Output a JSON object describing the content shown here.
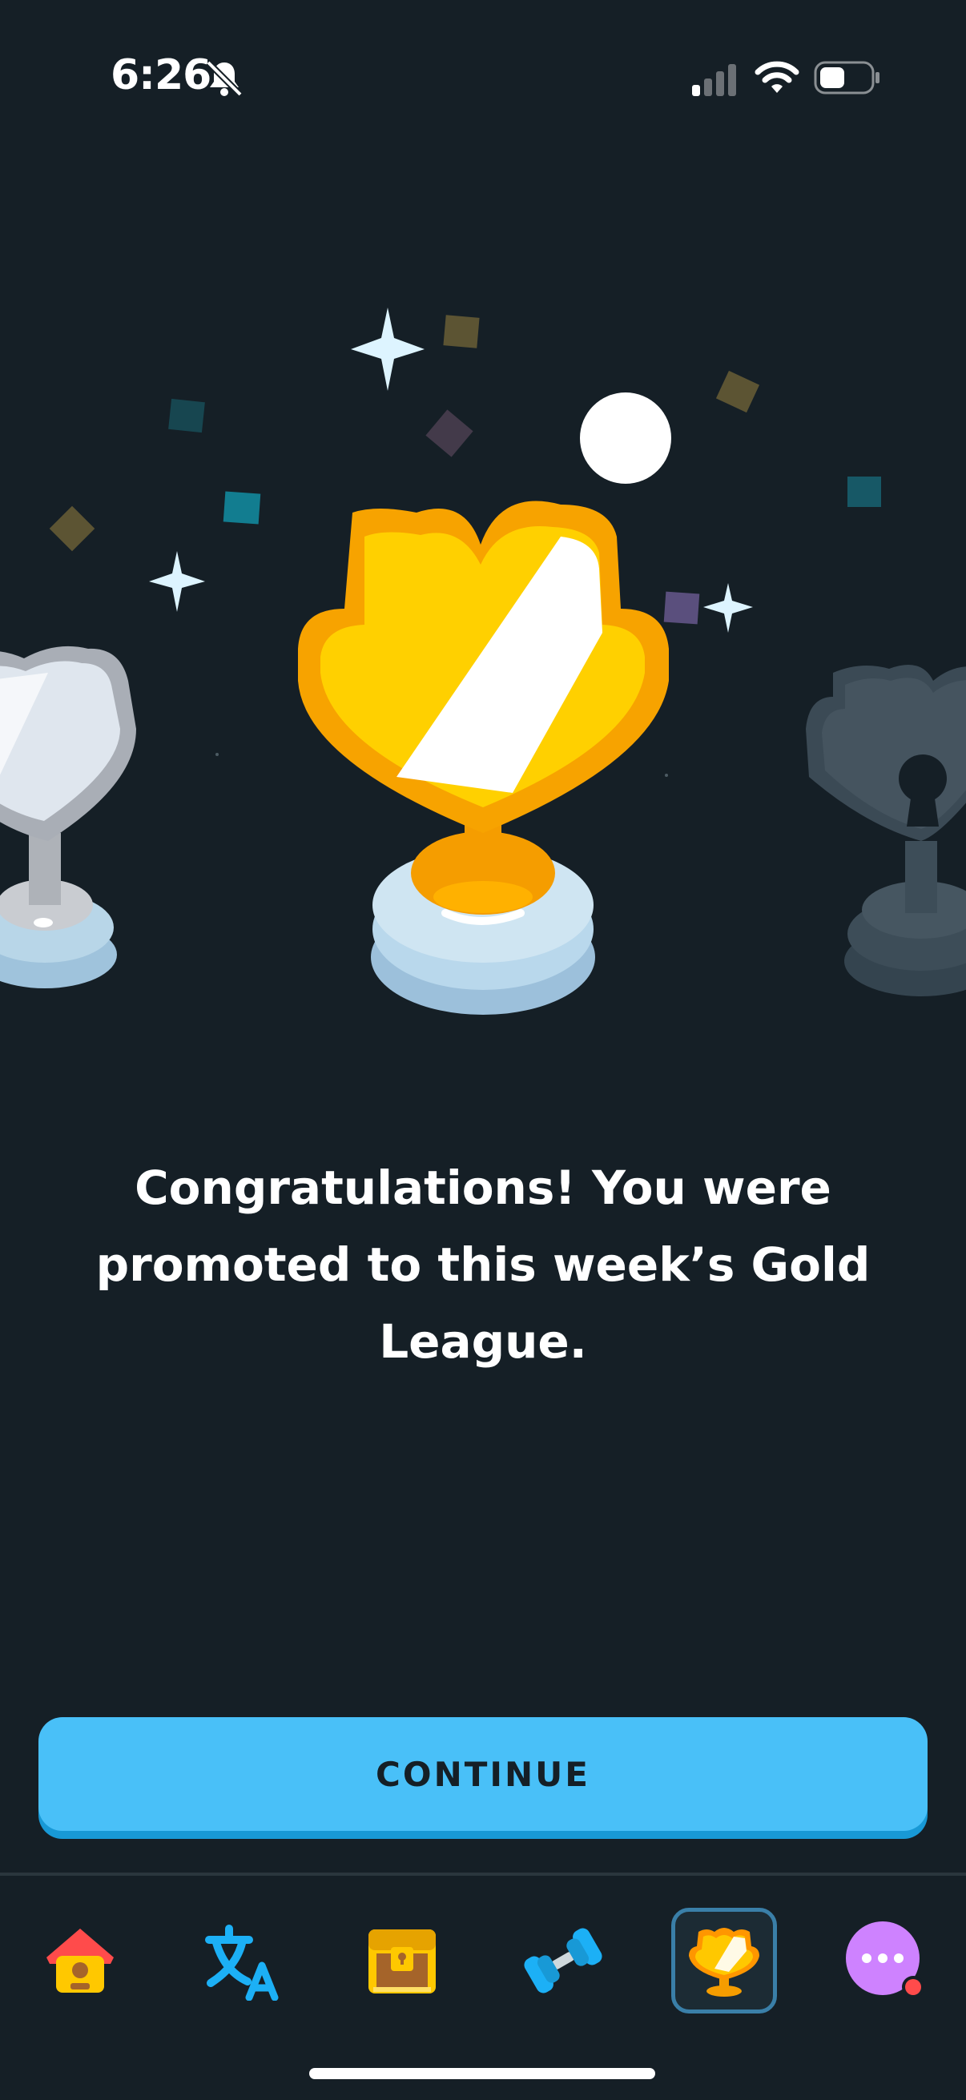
{
  "status_bar": {
    "time": "6:26",
    "icons": [
      "bell-slash-icon",
      "cellular-signal-icon",
      "wifi-icon",
      "battery-icon"
    ]
  },
  "league": {
    "trophies": [
      "silver-trophy",
      "gold-trophy",
      "locked-trophy"
    ],
    "current": "Gold"
  },
  "message": {
    "text": "Congratulations! You were promoted to this week’s Gold League."
  },
  "continue_button": {
    "label": "CONTINUE"
  },
  "tab_bar": {
    "tabs": [
      {
        "icon": "home-icon",
        "active": false
      },
      {
        "icon": "translate-icon",
        "active": false
      },
      {
        "icon": "treasure-chest-icon",
        "active": false
      },
      {
        "icon": "dumbbell-icon",
        "active": false
      },
      {
        "icon": "trophy-icon",
        "active": true
      },
      {
        "icon": "more-icon",
        "active": false
      }
    ]
  },
  "colors": {
    "background": "#151f26",
    "button": "#49c0f8",
    "gold": "#ffc700",
    "notification_dot": "#ff4b4b"
  }
}
